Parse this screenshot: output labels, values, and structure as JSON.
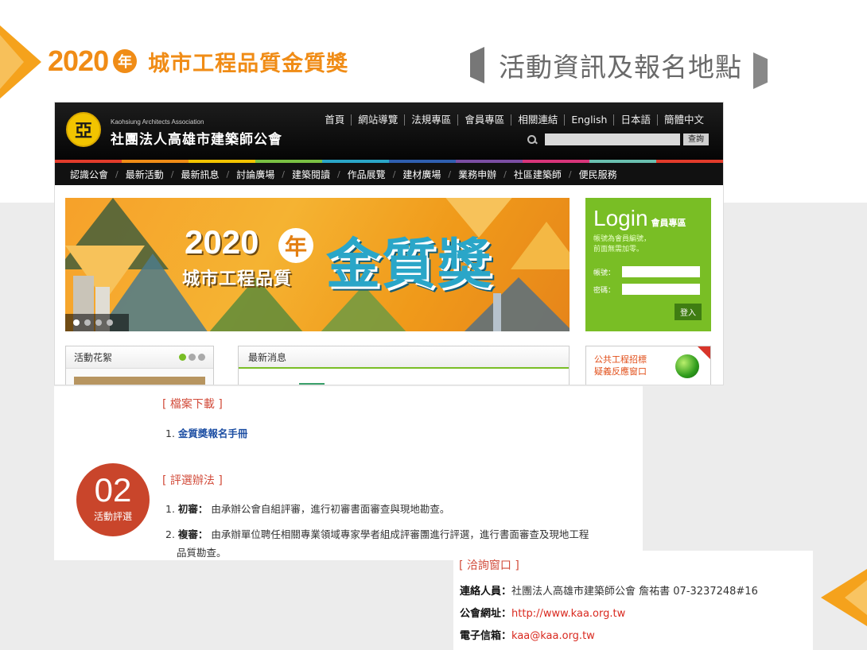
{
  "slide": {
    "year": "2020",
    "nian": "年",
    "award": "城市工程品質金質獎",
    "section": "活動資訊及報名地點"
  },
  "site": {
    "logo_glyph": "亞",
    "org_en": "Kaohsiung Architects Association",
    "org_zh": "社團法人高雄市建築師公會",
    "top_nav": [
      "首頁",
      "網站導覽",
      "法規專區",
      "會員專區",
      "相關連結",
      "English",
      "日本語",
      "簡體中文"
    ],
    "search_button": "查詢",
    "main_nav": [
      "認識公會",
      "最新活動",
      "最新訊息",
      "討論廣場",
      "建築閱讀",
      "作品展覽",
      "建材廣場",
      "業務申辦",
      "社區建築師",
      "便民服務"
    ],
    "banner": {
      "year": "2020",
      "nian": "年",
      "sub": "城市工程品質",
      "main": "金質獎"
    },
    "login": {
      "title": "Login",
      "subtitle": "會員專區",
      "note_line1": "帳號為會員編號，",
      "note_line2": "前面無需加零。",
      "account_label": "帳號：",
      "password_label": "密碼：",
      "button": "登入"
    },
    "gallery_title": "活動花絮",
    "news_title": "最新消息",
    "pw_line1": "公共工程招標",
    "pw_line2": "疑義反應窗口"
  },
  "info": {
    "download_head": "[ 檔案下載 ]",
    "download_item_num": "1.",
    "download_item": "金質獎報名手冊",
    "badge_num": "02",
    "badge_text": "活動評選",
    "rule_head": "[ 評選辦法 ]",
    "rule1_num": "1.",
    "rule1_label": "初審：",
    "rule1_text": "由承辦公會自組評審，進行初審書面審查與現地勘查。",
    "rule2_num": "2.",
    "rule2_label": "複審：",
    "rule2_text": "由承辦單位聘任相關專業領域專家學者組成評審團進行評選，進行書面審查及現地工程",
    "rule2_text2": "品質勘查。"
  },
  "contact": {
    "head": "[ 洽詢窗口 ]",
    "person_label": "連絡人員：",
    "person_value": "社團法人高雄市建築師公會 詹祐書 07-3237248#16",
    "web_label": "公會網址：",
    "web_value": "http://www.kaa.org.tw",
    "mail_label": "電子信箱：",
    "mail_value": "kaa@kaa.org.tw"
  },
  "colors": {
    "accent_orange": "#f08c16",
    "login_green": "#79be25",
    "badge_red": "#c9452b",
    "link_red": "#d9291f"
  }
}
